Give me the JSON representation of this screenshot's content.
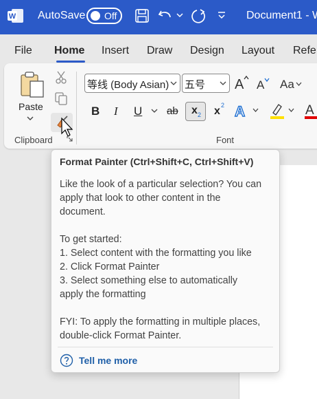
{
  "titlebar": {
    "autosave_label": "AutoSave",
    "autosave_state": "Off",
    "document_title": "Document1 - W",
    "colors": {
      "bar": "#2b5ac8",
      "text": "#ffffff"
    },
    "icons": [
      "word-logo-icon",
      "save-icon",
      "undo-icon",
      "undo-dropdown-icon",
      "redo-icon",
      "customize-toolbar-icon"
    ]
  },
  "tabs": [
    {
      "label": "File",
      "active": false
    },
    {
      "label": "Home",
      "active": true
    },
    {
      "label": "Insert",
      "active": false
    },
    {
      "label": "Draw",
      "active": false
    },
    {
      "label": "Design",
      "active": false
    },
    {
      "label": "Layout",
      "active": false
    },
    {
      "label": "Refe",
      "active": false
    }
  ],
  "ribbon": {
    "clipboard": {
      "paste_label": "Paste",
      "group_label": "Clipboard",
      "icons": [
        "paste-icon",
        "cut-icon",
        "copy-icon",
        "format-painter-icon",
        "dialog-launcher-icon"
      ]
    },
    "font": {
      "font_name": "等线 (Body Asian)",
      "font_size": "五号",
      "group_label": "Font",
      "buttons": [
        "B",
        "I",
        "U",
        "ab",
        "x",
        "x"
      ],
      "icons": [
        "grow-font-icon",
        "shrink-font-icon",
        "change-case-icon",
        "text-effects-icon",
        "highlight-icon",
        "font-color-icon"
      ],
      "colors": {
        "highlight": "#ffe000",
        "font_color": "#e00000",
        "text_effects": "#1f6fd1"
      }
    }
  },
  "tooltip": {
    "title": "Format Painter (Ctrl+Shift+C, Ctrl+Shift+V)",
    "body_lines": [
      "Like the look of a particular selection? You can",
      "apply that look to other content in the",
      "document."
    ],
    "steps_lines": [
      "To get started:",
      "1. Select content with the formatting you like",
      "2. Click Format Painter",
      "3. Select something else to automatically",
      "apply the formatting"
    ],
    "fyi_lines": [
      "FYI: To apply the formatting in multiple places,",
      "double-click Format Painter."
    ],
    "link_label": "Tell me more",
    "link_color": "#1f5fa8"
  }
}
